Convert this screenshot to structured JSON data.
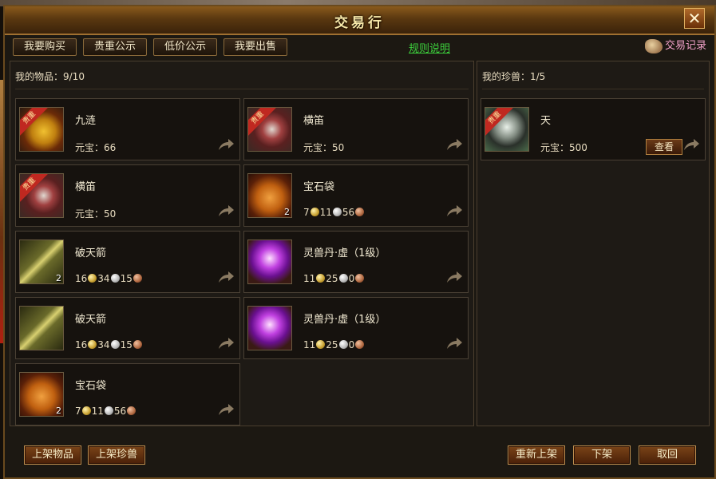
{
  "window": {
    "title": "交易行",
    "close_label": "✕"
  },
  "tabs": [
    {
      "label": "我要购买"
    },
    {
      "label": "贵重公示"
    },
    {
      "label": "低价公示"
    },
    {
      "label": "我要出售"
    }
  ],
  "rules_link": "规则说明",
  "trade_record": "交易记录",
  "items_panel": {
    "header": "我的物品：9/10",
    "items": [
      {
        "name": "九涟",
        "price_label": "元宝：",
        "price": "66",
        "ribbon": "贵重",
        "count": "",
        "icon": "amulet-icon"
      },
      {
        "name": "横笛",
        "price_label": "元宝：",
        "price": "50",
        "ribbon": "贵重",
        "count": "",
        "icon": "flute-icon"
      },
      {
        "name": "横笛",
        "price_label": "元宝：",
        "price": "50",
        "ribbon": "贵重",
        "count": "",
        "icon": "flute-icon"
      },
      {
        "name": "宝石袋",
        "gold": "7",
        "silver": "11",
        "copper": "56",
        "count": "2",
        "icon": "gem-bag-icon"
      },
      {
        "name": "破天箭",
        "gold": "16",
        "silver": "34",
        "copper": "15",
        "count": "2",
        "icon": "arrow-icon"
      },
      {
        "name": "灵兽丹·虚（1级）",
        "gold": "11",
        "silver": "25",
        "copper": "0",
        "count": "",
        "icon": "orb-icon"
      },
      {
        "name": "破天箭",
        "gold": "16",
        "silver": "34",
        "copper": "15",
        "count": "",
        "icon": "arrow-icon"
      },
      {
        "name": "灵兽丹·虚（1级）",
        "gold": "11",
        "silver": "25",
        "copper": "0",
        "count": "",
        "icon": "orb-icon"
      },
      {
        "name": "宝石袋",
        "gold": "7",
        "silver": "11",
        "copper": "56",
        "count": "2",
        "icon": "gem-bag-icon"
      }
    ]
  },
  "pets_panel": {
    "header": "我的珍兽：1/5",
    "pets": [
      {
        "name": "天",
        "price_label": "元宝：",
        "price": "500",
        "ribbon": "贵重",
        "view_label": "查看",
        "icon": "beast-icon"
      }
    ]
  },
  "footer": {
    "list_item": "上架物品",
    "list_pet": "上架珍兽",
    "relist": "重新上架",
    "delist": "下架",
    "retrieve": "取回"
  }
}
